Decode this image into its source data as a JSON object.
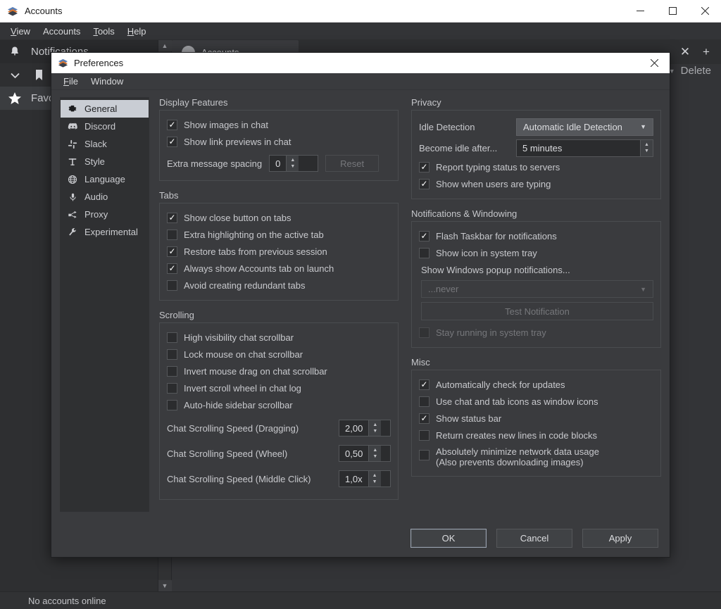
{
  "app_window": {
    "title": "Accounts",
    "icon": "stack-icon",
    "controls": {
      "minimize": "─",
      "maximize": "□",
      "close": "✕"
    },
    "menus": [
      {
        "label": "View",
        "mnemonic": "V"
      },
      {
        "label": "Accounts",
        "mnemonic": "A"
      },
      {
        "label": "Tools",
        "mnemonic": "T"
      },
      {
        "label": "Help",
        "mnemonic": "H"
      }
    ],
    "sidebar": [
      {
        "label": "Notifications",
        "icon": "bell-icon"
      },
      {
        "label": "",
        "icon": "bookmark-icon",
        "secondary_icon": "chevron-down-icon"
      },
      {
        "label": "Favo",
        "icon": "star-icon"
      }
    ],
    "tabs": [
      {
        "label": "Accounts",
        "avatar": "user-avatar"
      }
    ],
    "tab_controls": {
      "close": "✕",
      "add": "+"
    },
    "delete_label": "Delete",
    "delete_caret": "▼",
    "search_clear_icon": "✕",
    "statusbar": "No accounts online"
  },
  "prefs": {
    "title": "Preferences",
    "icon": "stack-icon",
    "close_icon": "✕",
    "menus": [
      {
        "label": "File",
        "mnemonic": "F"
      },
      {
        "label": "Window",
        "mnemonic": ""
      }
    ],
    "nav": [
      {
        "label": "General",
        "icon": "gear-icon",
        "selected": true
      },
      {
        "label": "Discord",
        "icon": "discord-icon",
        "selected": false
      },
      {
        "label": "Slack",
        "icon": "slack-icon",
        "selected": false
      },
      {
        "label": "Style",
        "icon": "text-style-icon",
        "selected": false
      },
      {
        "label": "Language",
        "icon": "globe-icon",
        "selected": false
      },
      {
        "label": "Audio",
        "icon": "microphone-icon",
        "selected": false
      },
      {
        "label": "Proxy",
        "icon": "proxy-nodes-icon",
        "selected": false
      },
      {
        "label": "Experimental",
        "icon": "wrench-icon",
        "selected": false
      }
    ],
    "display_features": {
      "title": "Display Features",
      "checkboxes": [
        {
          "label": "Show images in chat",
          "checked": true
        },
        {
          "label": "Show link previews in chat",
          "checked": true
        }
      ],
      "spacing_label": "Extra message spacing",
      "spacing_value": "0",
      "reset_label": "Reset",
      "reset_disabled": true
    },
    "tabs_group": {
      "title": "Tabs",
      "checkboxes": [
        {
          "label": "Show close button on tabs",
          "checked": true
        },
        {
          "label": "Extra highlighting on the active tab",
          "checked": false
        },
        {
          "label": "Restore tabs from previous session",
          "checked": true
        },
        {
          "label": "Always show Accounts tab on launch",
          "checked": true
        },
        {
          "label": "Avoid creating redundant tabs",
          "checked": false
        }
      ]
    },
    "scrolling": {
      "title": "Scrolling",
      "checkboxes": [
        {
          "label": "High visibility chat scrollbar",
          "checked": false
        },
        {
          "label": "Lock mouse on chat scrollbar",
          "checked": false
        },
        {
          "label": "Invert mouse drag on chat scrollbar",
          "checked": false
        },
        {
          "label": "Invert scroll wheel in chat log",
          "checked": false
        },
        {
          "label": "Auto-hide sidebar scrollbar",
          "checked": false
        }
      ],
      "speeds": [
        {
          "label": "Chat Scrolling Speed (Dragging)",
          "value": "2,00"
        },
        {
          "label": "Chat Scrolling Speed (Wheel)",
          "value": "0,50"
        },
        {
          "label": "Chat Scrolling Speed (Middle Click)",
          "value": "1,0x"
        }
      ]
    },
    "privacy": {
      "title": "Privacy",
      "idle_detection_label": "Idle Detection",
      "idle_detection_value": "Automatic Idle Detection",
      "become_idle_label": "Become idle after...",
      "become_idle_value": "5 minutes",
      "checkboxes": [
        {
          "label": "Report typing status to servers",
          "checked": true
        },
        {
          "label": "Show when users are typing",
          "checked": true
        }
      ]
    },
    "notifications": {
      "title": "Notifications & Windowing",
      "checkboxes": [
        {
          "label": "Flash Taskbar for notifications",
          "checked": true,
          "disabled": false
        },
        {
          "label": "Show icon in system tray",
          "checked": false,
          "disabled": false
        }
      ],
      "popup_label": "Show Windows popup notifications...",
      "popup_value": "...never",
      "popup_disabled": true,
      "test_label": "Test Notification",
      "test_disabled": true,
      "stay_running_label": "Stay running in system tray",
      "stay_running_checked": false,
      "stay_running_disabled": true
    },
    "misc": {
      "title": "Misc",
      "checkboxes": [
        {
          "label": "Automatically check for updates",
          "checked": true,
          "line2": ""
        },
        {
          "label": "Use chat and tab icons as window icons",
          "checked": false,
          "line2": ""
        },
        {
          "label": "Show status bar",
          "checked": true,
          "line2": ""
        },
        {
          "label": "Return creates new lines in code blocks",
          "checked": false,
          "line2": ""
        },
        {
          "label": "Absolutely minimize network data usage",
          "checked": false,
          "line2": "(Also prevents downloading images)"
        }
      ]
    },
    "footer": {
      "ok": "OK",
      "cancel": "Cancel",
      "apply": "Apply"
    }
  }
}
